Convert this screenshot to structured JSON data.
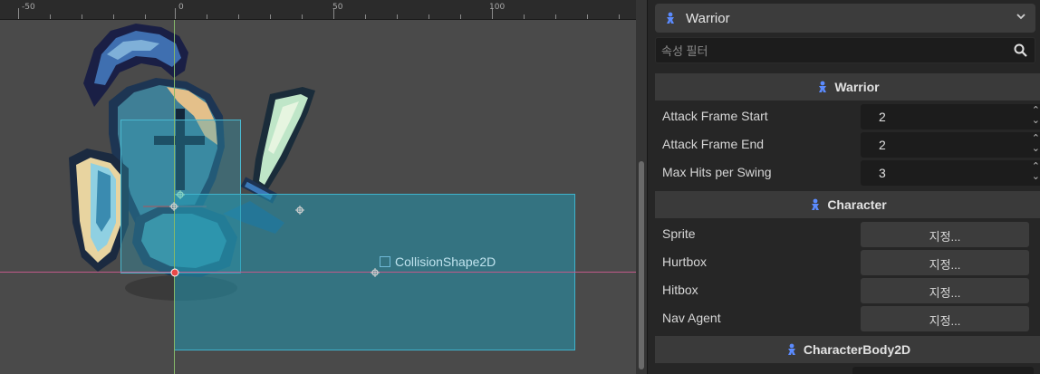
{
  "ruler": {
    "ticks": [
      "-50",
      "0",
      "50",
      "100"
    ]
  },
  "viewport": {
    "collision_label": "CollisionShape2D"
  },
  "inspector": {
    "node_name": "Warrior",
    "filter_placeholder": "속성 필터",
    "sections": [
      {
        "title": "Warrior"
      },
      {
        "title": "Character"
      },
      {
        "title": "CharacterBody2D"
      }
    ],
    "number_props": [
      {
        "label": "Attack Frame Start",
        "value": "2"
      },
      {
        "label": "Attack Frame End",
        "value": "2"
      },
      {
        "label": "Max Hits per Swing",
        "value": "3"
      }
    ],
    "node_props": [
      {
        "label": "Sprite",
        "button": "지정..."
      },
      {
        "label": "Hurtbox",
        "button": "지정..."
      },
      {
        "label": "Hitbox",
        "button": "지정..."
      },
      {
        "label": "Nav Agent",
        "button": "지정..."
      }
    ]
  },
  "icons": {
    "node": "character-node-icon",
    "dropdown": "chevron-down-icon",
    "search": "search-icon",
    "menu": "kebab-menu-icon"
  },
  "colors": {
    "node_icon": "#5b8bff",
    "collision_fill": "#2296af",
    "guide_vertical": "#86b86a",
    "guide_horizontal": "#c05a8a"
  }
}
